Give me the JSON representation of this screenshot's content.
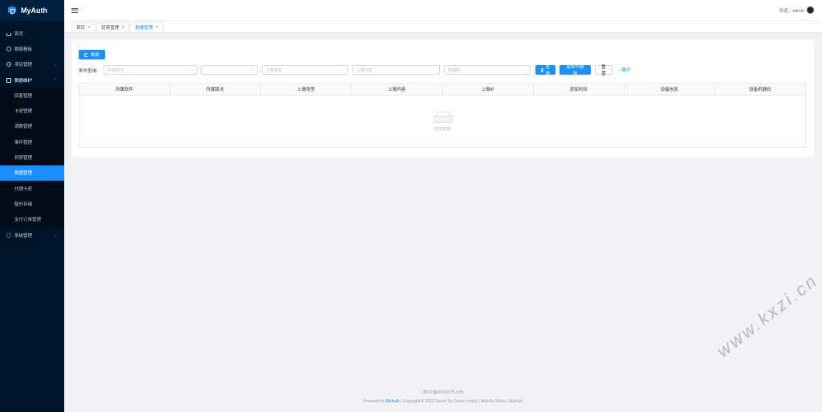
{
  "app": {
    "name": "MyAuth"
  },
  "sidebar": {
    "items": [
      {
        "label": "首页",
        "icon": "home-icon"
      },
      {
        "label": "数据看板",
        "icon": "dashboard-icon"
      },
      {
        "label": "项目管理",
        "icon": "project-icon",
        "chevron": "⌄"
      },
      {
        "label": "数据维护",
        "icon": "database-icon",
        "chevron": "⌃"
      }
    ],
    "sub_items": [
      {
        "label": "回复管理"
      },
      {
        "label": "卡密管理"
      },
      {
        "label": "调数管理"
      },
      {
        "label": "事件管理"
      },
      {
        "label": "封禁管理"
      },
      {
        "label": "数据管理",
        "active": true
      },
      {
        "label": "代理卡密"
      },
      {
        "label": "额外存储"
      },
      {
        "label": "支付订单管理"
      }
    ],
    "system": {
      "label": "系统管理",
      "icon": "settings-icon",
      "chevron": "⌄"
    }
  },
  "header": {
    "welcome": "欢迎，admin"
  },
  "tabs": [
    {
      "label": "首页"
    },
    {
      "label": "封禁管理"
    },
    {
      "label": "数据管理",
      "active": true
    }
  ],
  "toolbar": {
    "refresh_label": "刷新"
  },
  "filter": {
    "label": "条件查询:",
    "software_placeholder": "所属软件",
    "version_placeholder": "",
    "type_placeholder": "上报类型",
    "content_placeholder": "上报内容",
    "machine_placeholder": "机器码",
    "search_label": "查 询",
    "delete_label": "按条件删除",
    "reset_label": "重 置",
    "expand_label": "展开"
  },
  "table": {
    "columns": [
      "所属软件",
      "所属版本",
      "上报类型",
      "上报内容",
      "上报IP",
      "添加时间",
      "设备信息",
      "设备机器码"
    ],
    "empty_text": "暂无数据"
  },
  "footer": {
    "icp": "浙ICP备000001号-1(B)",
    "powered_prefix": "Powered by ",
    "powered_link": "MyAuth",
    "rest": " | Copyright © 2022 Server By Dawn.Lonely | Web By Shine | MyAuth"
  },
  "watermark": "www.kxzi.cn",
  "colors": {
    "sidebar": "#001529",
    "primary": "#1890ff"
  }
}
